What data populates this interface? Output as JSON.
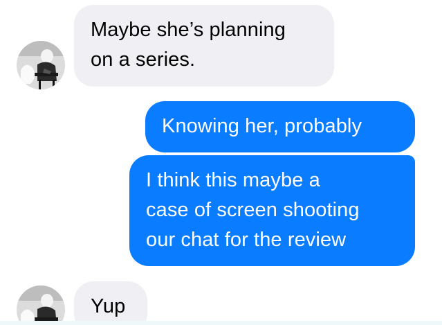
{
  "messages": [
    {
      "direction": "incoming",
      "lines": [
        "Maybe she’s planning",
        "on a series."
      ]
    },
    {
      "direction": "outgoing",
      "lines": [
        "Knowing her, probably"
      ]
    },
    {
      "direction": "outgoing",
      "lines": [
        "I think this maybe a",
        "case of screen shooting",
        "our chat for the review"
      ]
    },
    {
      "direction": "incoming",
      "lines": [
        "Yup"
      ]
    }
  ],
  "colors": {
    "incoming_bubble": "#efeff4",
    "outgoing_bubble": "#0a7cff",
    "outgoing_text": "#ffffff",
    "incoming_text": "#000000"
  },
  "icons": {
    "avatar": "contact-avatar-photo"
  }
}
